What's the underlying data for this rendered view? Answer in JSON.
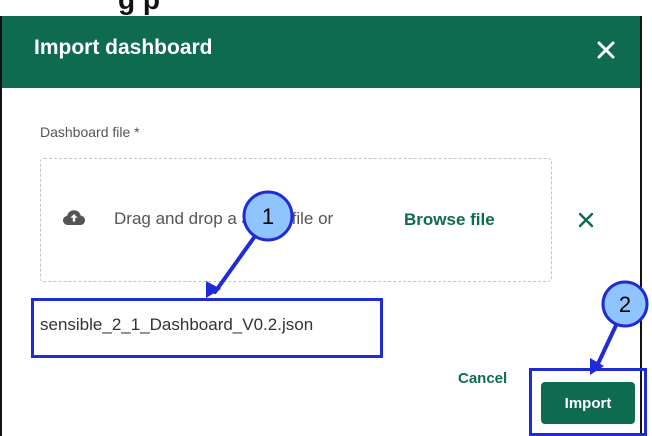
{
  "top_strip": {
    "text": "g     p"
  },
  "dialog": {
    "title": "Import dashboard",
    "field_label": "Dashboard file *",
    "dropzone": {
      "text": "Drag and drop a JSON file or",
      "browse_label": "Browse file"
    },
    "filename": "sensible_2_1_Dashboard_V0.2.json",
    "cancel_label": "Cancel",
    "import_label": "Import"
  },
  "annotations": {
    "badge_1": "1",
    "badge_2": "2",
    "color": "#1e2bd6"
  },
  "icons": {
    "close": "close-icon",
    "upload": "cloud-upload-icon",
    "clear": "clear-icon"
  },
  "colors": {
    "header_bg": "#0f6b4f",
    "primary": "#0f6b4f",
    "annotation": "#1e2bd6",
    "badge_fill": "#8fc4ff"
  }
}
